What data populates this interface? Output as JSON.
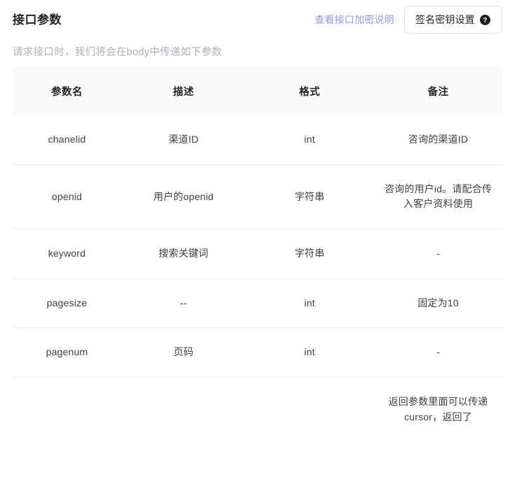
{
  "header": {
    "title": "接口参数",
    "doc_link": "查看接口加密说明",
    "key_button": "签名密钥设置",
    "help_icon": "question-circle-icon"
  },
  "subtitle": "请求接口时，我们将会在body中传递如下参数",
  "table": {
    "columns": [
      "参数名",
      "描述",
      "格式",
      "备注"
    ],
    "rows": [
      {
        "name": "chanelid",
        "desc": "渠道ID",
        "format": "int",
        "note": "咨询的渠道ID"
      },
      {
        "name": "openid",
        "desc": "用户的openid",
        "format": "字符串",
        "note": "咨询的用户id。请配合传入客户资料使用"
      },
      {
        "name": "keyword",
        "desc": "搜索关键词",
        "format": "字符串",
        "note": "-"
      },
      {
        "name": "pagesize",
        "desc": "--",
        "format": "int",
        "note": "固定为10"
      },
      {
        "name": "pagenum",
        "desc": "页码",
        "format": "int",
        "note": "-"
      },
      {
        "name": "",
        "desc": "",
        "format": "",
        "note": "返回参数里面可以传递cursor，返回了"
      }
    ]
  },
  "colors": {
    "link": "#8b9bf2",
    "title": "#1f2329",
    "subtitle": "#aeb2bb",
    "table_header_bg": "#fafafa",
    "row_divider": "#ececec",
    "button_border": "#dcdfe6"
  }
}
